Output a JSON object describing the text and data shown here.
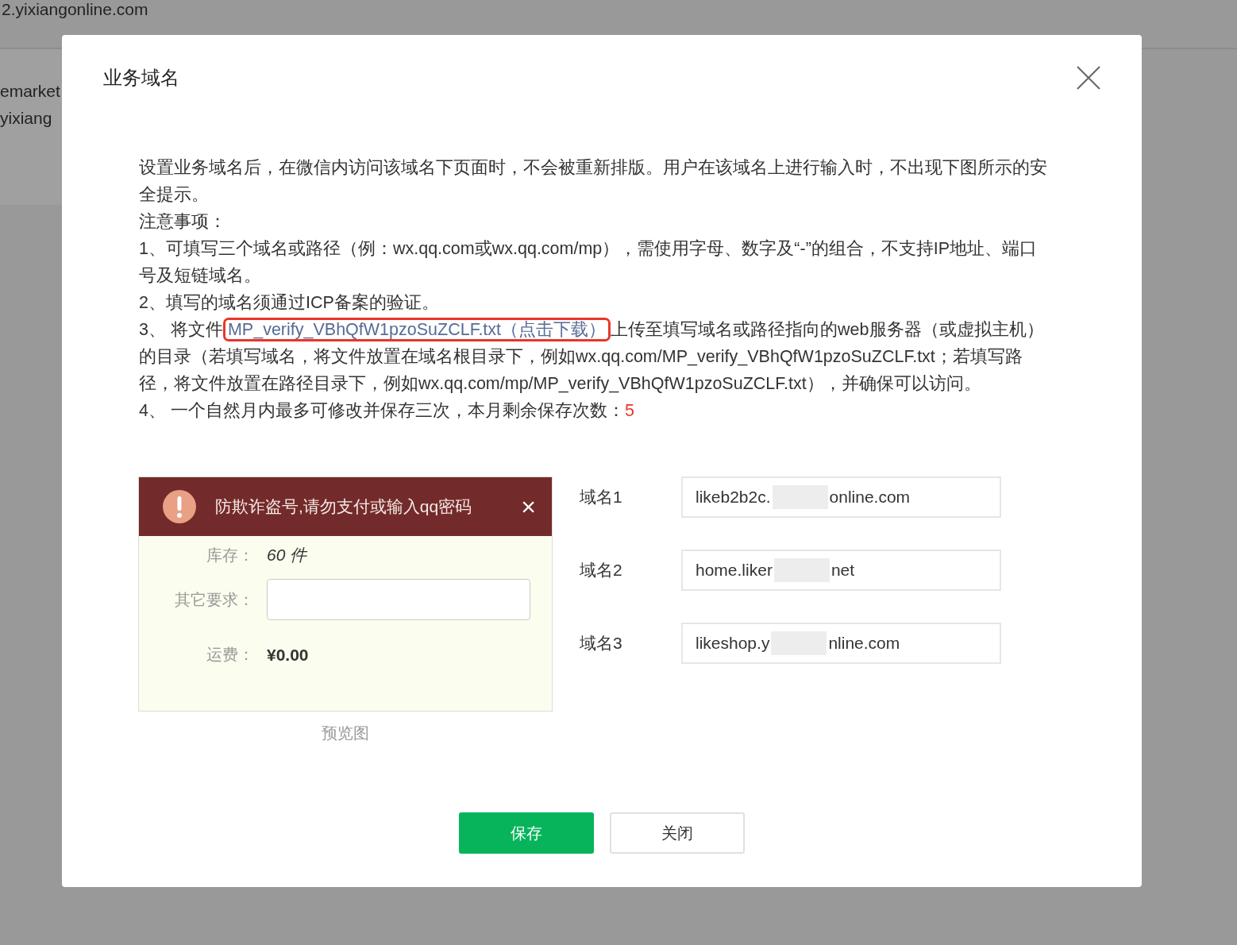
{
  "background_page": {
    "url": "2.yixiangonline.com",
    "lines": [
      "emarket",
      "yixiang"
    ]
  },
  "dialog": {
    "title": "业务域名",
    "intro": "设置业务域名后，在微信内访问该域名下页面时，不会被重新排版。用户在该域名上进行输入时，不出现下图所示的安全提示。",
    "notes_heading": "注意事项：",
    "note_1": "1、可填写三个域名或路径（例：wx.qq.com或wx.qq.com/mp），需使用字母、数字及“-”的组合，不支持IP地址、端口号及短链域名。",
    "note_2": "2、填写的域名须通过ICP备案的验证。",
    "note_3": {
      "prefix": "3、 将文件",
      "link": "MP_verify_VBhQfW1pzoSuZCLF.txt（点击下载）",
      "rest": "上传至填写域名或路径指向的web服务器（或虚拟主机）的目录（若填写域名，将文件放置在域名根目录下，例如wx.qq.com/MP_verify_VBhQfW1pzoSuZCLF.txt；若填写路径，将文件放置在路径目录下，例如wx.qq.com/mp/MP_verify_VBhQfW1pzoSuZCLF.txt），并确保可以访问。"
    },
    "note_4": {
      "text": "4、 一个自然月内最多可修改并保存三次，本月剩余保存次数：",
      "count": "5"
    },
    "preview": {
      "warning": "防欺诈盗号,请勿支付或输入qq密码",
      "close": "×",
      "stock_label": "库存：",
      "stock_value": "60 件",
      "other_label": "其它要求：",
      "shipping_label": "运费：",
      "shipping_value": "¥0.00",
      "caption": "预览图"
    },
    "domains": [
      {
        "label": "域名1",
        "value_start": "likeb2b2c.",
        "value_end": "online.com"
      },
      {
        "label": "域名2",
        "value_start": "home.liker",
        "value_end": "net"
      },
      {
        "label": "域名3",
        "value_start": "likeshop.y",
        "value_end": "nline.com"
      }
    ],
    "buttons": [
      {
        "label": "保存",
        "kind": "primary"
      },
      {
        "label": "关闭",
        "kind": "secondary"
      }
    ]
  }
}
